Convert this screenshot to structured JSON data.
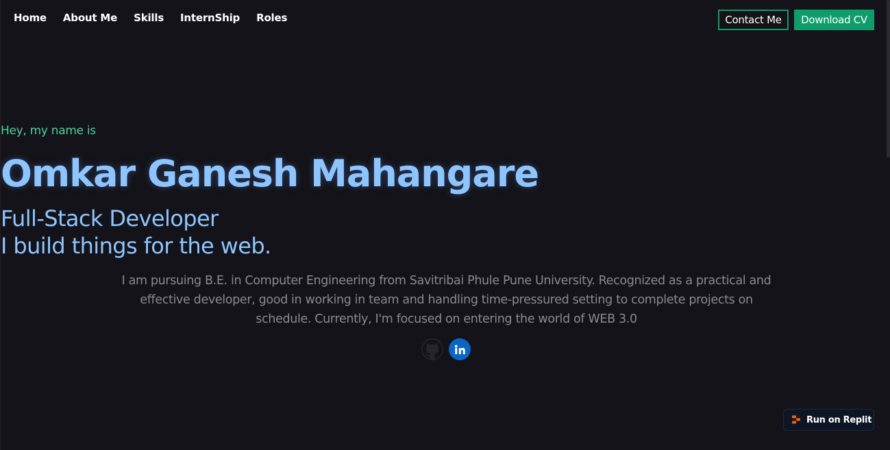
{
  "nav": {
    "links": [
      "Home",
      "About Me",
      "Skills",
      "InternShip",
      "Roles"
    ],
    "contact_label": "Contact Me",
    "cv_label": "Download CV"
  },
  "hero": {
    "greeting": "Hey, my name is",
    "name": "Omkar Ganesh Mahangare",
    "role": "Full-Stack Developer",
    "tagline": "I build things for the web.",
    "bio": "I am pursuing B.E. in Computer Engineering from Savitribai Phule Pune University. Recognized as a practical and effective developer, good in working in team and handling time-pressured setting to complete projects on schedule. Currently, I'm focused on entering the world of WEB 3.0"
  },
  "socials": [
    {
      "icon": "github-icon"
    },
    {
      "icon": "linkedin-icon"
    }
  ],
  "replit": {
    "label": "Run on Replit"
  },
  "colors": {
    "background": "#141319",
    "accent_green": "#0f9d6b",
    "greeting_green": "#4fd19a",
    "heading_blue": "#8ec5ff",
    "body_gray": "#8a8a93",
    "linkedin_blue": "#0a66c2"
  }
}
